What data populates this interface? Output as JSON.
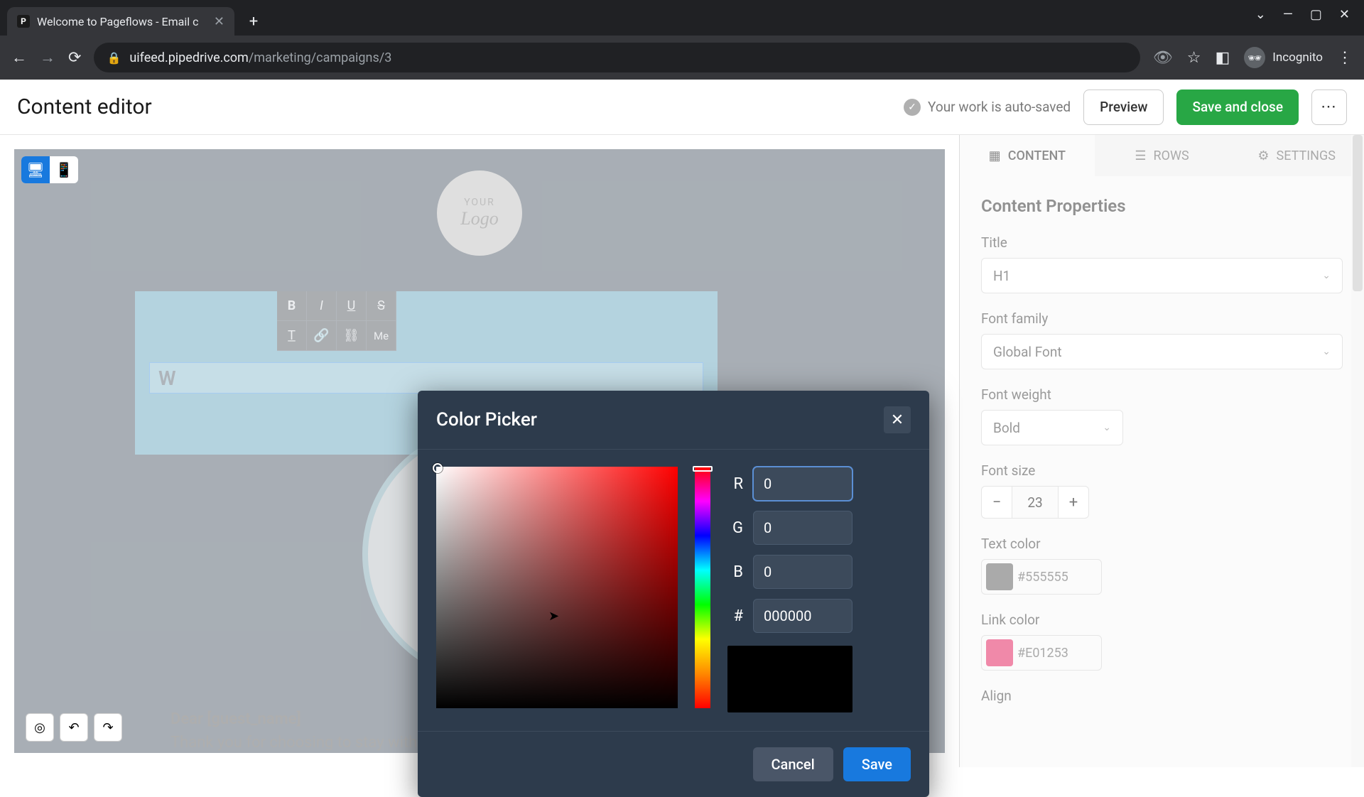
{
  "browser": {
    "tab_title": "Welcome to Pageflows - Email c",
    "url_domain": "uifeed.pipedrive.com",
    "url_path": "/marketing/campaigns/3",
    "incognito_label": "Incognito"
  },
  "header": {
    "title": "Content editor",
    "autosave": "Your work is auto-saved",
    "preview": "Preview",
    "save_close": "Save and close"
  },
  "email": {
    "logo_your": "YOUR",
    "logo_logo": "Logo",
    "welcome_w": "W",
    "toolbar_me": "Me",
    "body_line1": "Dear [guest_name]",
    "body_line2": "Thank you for choosing to stay with Laguna Sunrise Resort."
  },
  "picker": {
    "title": "Color Picker",
    "label_r": "R",
    "label_g": "G",
    "label_b": "B",
    "label_hex": "#",
    "val_r": "0",
    "val_g": "0",
    "val_b": "0",
    "val_hex": "000000",
    "cancel": "Cancel",
    "save": "Save"
  },
  "panel": {
    "tab_content": "CONTENT",
    "tab_rows": "ROWS",
    "tab_settings": "SETTINGS",
    "heading": "Content Properties",
    "title_label": "Title",
    "title_value": "H1",
    "font_family_label": "Font family",
    "font_family_value": "Global Font",
    "font_weight_label": "Font weight",
    "font_weight_value": "Bold",
    "font_size_label": "Font size",
    "font_size_value": "23",
    "text_color_label": "Text color",
    "text_color_value": "#555555",
    "text_color_hex": "#555555",
    "link_color_label": "Link color",
    "link_color_value": "#E01253",
    "link_color_hex": "#E01253",
    "align_label": "Align"
  }
}
